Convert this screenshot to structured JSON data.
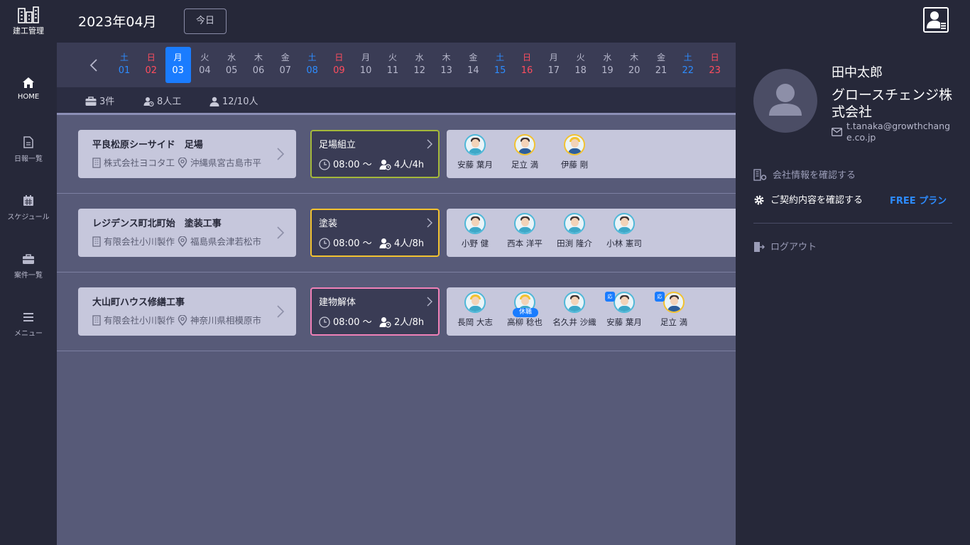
{
  "app": {
    "logo_text": "建工管理"
  },
  "header": {
    "month": "2023年04月",
    "today_label": "今日"
  },
  "sidebar": {
    "items": [
      {
        "label": "HOME"
      },
      {
        "label": "日報一覧"
      },
      {
        "label": "スケジュール"
      },
      {
        "label": "案件一覧"
      },
      {
        "label": "メニュー"
      }
    ]
  },
  "calendar": {
    "days": [
      {
        "dow": "土",
        "num": "01",
        "color": "blue"
      },
      {
        "dow": "日",
        "num": "02",
        "color": "red"
      },
      {
        "dow": "月",
        "num": "03",
        "color": "white",
        "selected": true
      },
      {
        "dow": "火",
        "num": "04",
        "color": "gray"
      },
      {
        "dow": "水",
        "num": "05",
        "color": "gray"
      },
      {
        "dow": "木",
        "num": "06",
        "color": "gray"
      },
      {
        "dow": "金",
        "num": "07",
        "color": "gray"
      },
      {
        "dow": "土",
        "num": "08",
        "color": "blue"
      },
      {
        "dow": "日",
        "num": "09",
        "color": "red"
      },
      {
        "dow": "月",
        "num": "10",
        "color": "gray"
      },
      {
        "dow": "火",
        "num": "11",
        "color": "gray"
      },
      {
        "dow": "水",
        "num": "12",
        "color": "gray"
      },
      {
        "dow": "木",
        "num": "13",
        "color": "gray"
      },
      {
        "dow": "金",
        "num": "14",
        "color": "gray"
      },
      {
        "dow": "土",
        "num": "15",
        "color": "blue"
      },
      {
        "dow": "日",
        "num": "16",
        "color": "red"
      },
      {
        "dow": "月",
        "num": "17",
        "color": "gray"
      },
      {
        "dow": "火",
        "num": "18",
        "color": "gray"
      },
      {
        "dow": "水",
        "num": "19",
        "color": "gray"
      },
      {
        "dow": "木",
        "num": "20",
        "color": "gray"
      },
      {
        "dow": "金",
        "num": "21",
        "color": "gray"
      },
      {
        "dow": "土",
        "num": "22",
        "color": "blue"
      },
      {
        "dow": "日",
        "num": "23",
        "color": "red"
      }
    ]
  },
  "stats": {
    "projects": "3件",
    "manpower": "8人工",
    "people": "12/10人"
  },
  "rows": [
    {
      "site": "平良松原シーサイド　足場",
      "company": "株式会社ヨコタ工",
      "address": "沖縄県宮古島市平",
      "task": "足場組立",
      "task_color": "#a4b83a",
      "time": "08:00 ～",
      "manpower": "4人/4h",
      "workers": [
        {
          "name": "安藤 葉月",
          "style": "blue"
        },
        {
          "name": "足立 満",
          "style": "yellow"
        },
        {
          "name": "伊藤 剛",
          "style": "yellow-helmet"
        }
      ]
    },
    {
      "site": "レジデンス町北町始　塗装工事",
      "company": "有限会社小川製作",
      "address": "福島県会津若松市",
      "task": "塗装",
      "task_color": "#f2c230",
      "time": "08:00 ～",
      "manpower": "4人/8h",
      "workers": [
        {
          "name": "小野 健",
          "style": "blue"
        },
        {
          "name": "西本 洋平",
          "style": "blue"
        },
        {
          "name": "田渕 隆介",
          "style": "blue"
        },
        {
          "name": "小林 憲司",
          "style": "blue"
        }
      ]
    },
    {
      "site": "大山町ハウス修繕工事",
      "company": "有限会社小川製作",
      "address": "神奈川県相模原市",
      "task": "建物解体",
      "task_color": "#f081b8",
      "time": "08:00 ～",
      "manpower": "2人/8h",
      "workers": [
        {
          "name": "長岡 大志",
          "style": "blue-helmet"
        },
        {
          "name": "高柳 稔也",
          "style": "blue-helmet",
          "badge": "休職"
        },
        {
          "name": "名久井 沙織",
          "style": "blue"
        },
        {
          "name": "安藤 葉月",
          "style": "blue",
          "cert": "応"
        },
        {
          "name": "足立 満",
          "style": "yellow",
          "cert": "応"
        }
      ]
    }
  ],
  "panel": {
    "user_name": "田中太郎",
    "company": "グロースチェンジ株式会社",
    "email": "t.tanaka@growthchange.co.jp",
    "company_info_label": "会社情報を確認する",
    "contract_label": "ご契約内容を確認する",
    "plan_label": "FREE プラン",
    "logout_label": "ログアウト"
  },
  "colors": {
    "accent": "#1a7cff",
    "sunday": "#ff4d5e",
    "saturday": "#2d8cff"
  }
}
